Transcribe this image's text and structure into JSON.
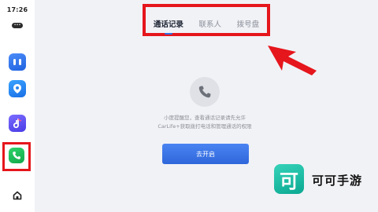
{
  "status": {
    "time": "17:26",
    "mini_badge": "•••"
  },
  "sidebar": {
    "items": [
      {
        "name": "cards-app-icon"
      },
      {
        "name": "maps-app-icon"
      },
      {
        "name": "music-app-icon"
      },
      {
        "name": "phone-app-icon",
        "selected": true
      },
      {
        "name": "home-icon"
      }
    ]
  },
  "tabs": [
    {
      "label": "通话记录",
      "active": true
    },
    {
      "label": "联系人",
      "active": false
    },
    {
      "label": "拨号盘",
      "active": false
    }
  ],
  "empty_state": {
    "icon": "phone-icon",
    "line1": "小度提醒您，查看通话记录请先允许",
    "line2": "CarLife+获取拨打电话和管理通话的权限",
    "button_label": "去开启"
  },
  "watermark": {
    "logo_char": "可",
    "text": "可可手游"
  },
  "colors": {
    "highlight": "#e5161c",
    "accent": "#2f6fe4",
    "button": "#3a74e6",
    "watermark_green": "#17b89f"
  }
}
